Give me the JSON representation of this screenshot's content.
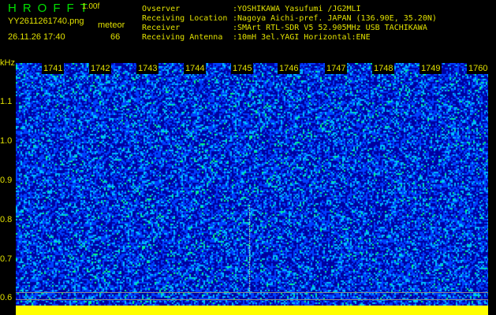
{
  "header": {
    "app_title": "HROFFT",
    "version": "1.00f",
    "filename": "YY2611261740.png",
    "datetime": "26.11.26 17:40",
    "type_label": "meteor",
    "count": "66",
    "info": [
      {
        "key": "Ovserver",
        "value": ":YOSHIKAWA Yasufumi /JG2MLI"
      },
      {
        "key": "Receiving Location",
        "value": ":Nagoya Aichi-pref. JAPAN (136.90E, 35.20N)"
      },
      {
        "key": "Receiver",
        "value": ":SMArt RTL-SDR V5 52.905MHz USB TACHIKAWA"
      },
      {
        "key": "Receiving Antenna",
        "value": ":10mH 3el.YAGI Horizontal:ENE"
      }
    ]
  },
  "spectrogram": {
    "y_unit": "kHz",
    "y_ticks": [
      "1.1",
      "1.0",
      "0.9",
      "0.8",
      "0.7",
      "0.6"
    ],
    "x_ticks": [
      "1741",
      "1742",
      "1743",
      "1744",
      "1745",
      "1746",
      "1747",
      "1748",
      "1749",
      "1760"
    ],
    "colors": {
      "background": "#0000a0",
      "noise_low": "#0040ff",
      "noise_mid": "#00c0ff",
      "noise_high": "#00ff80",
      "axis": "#e0e000",
      "bottom_bar": "#ffff00"
    }
  }
}
